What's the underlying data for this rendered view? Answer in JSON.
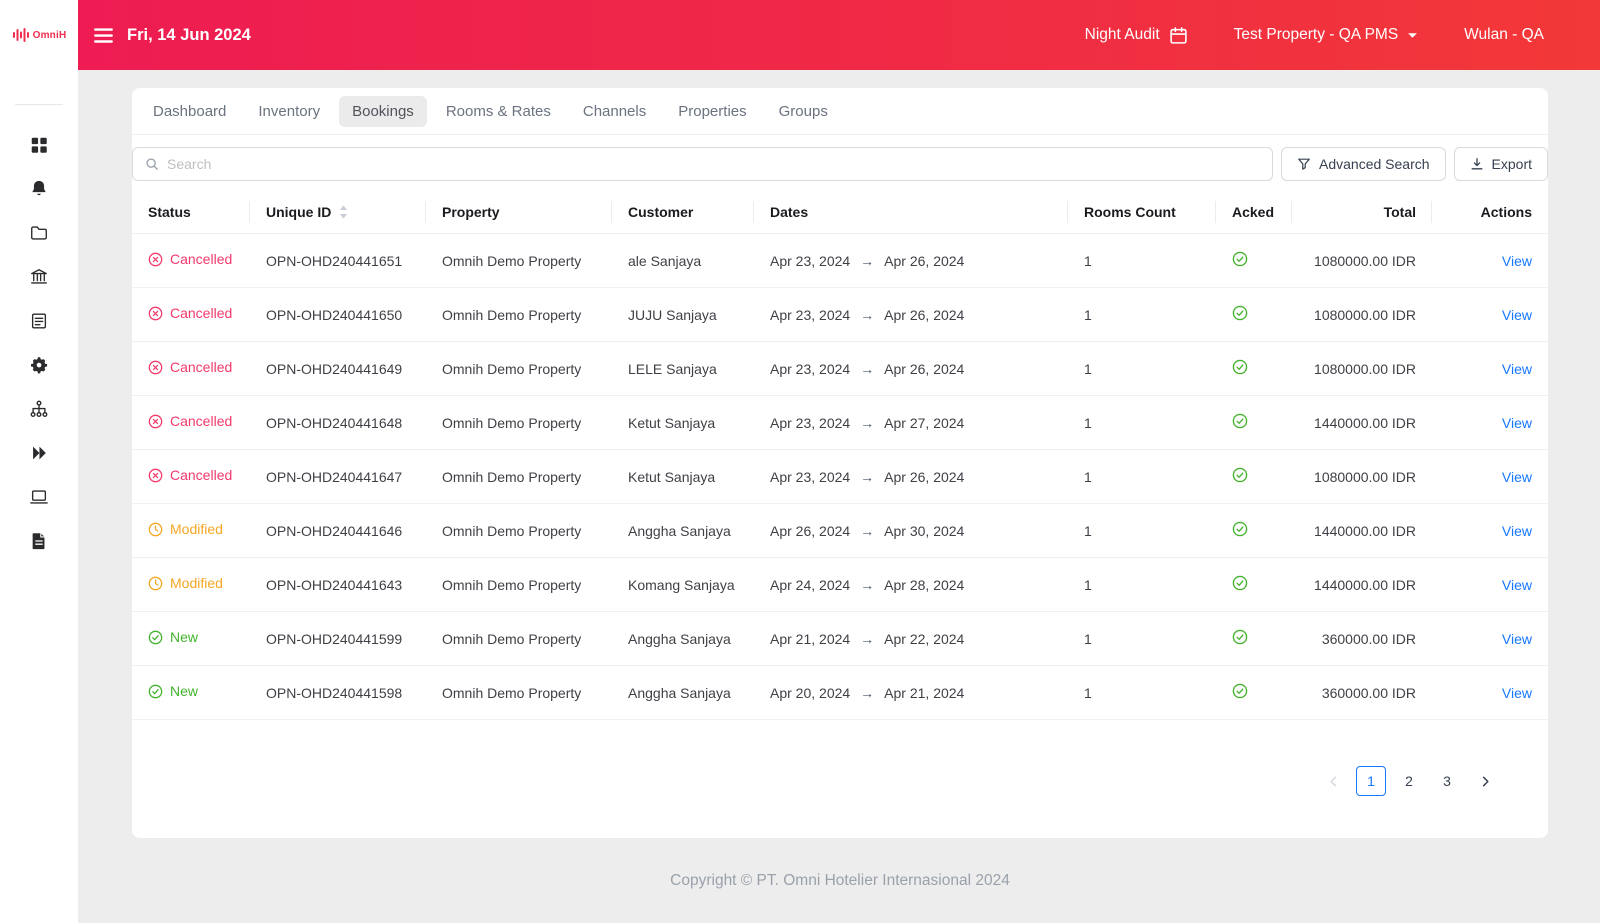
{
  "brand": {
    "logo_text": "OmniH"
  },
  "header": {
    "date": "Fri, 14 Jun 2024",
    "night_audit": "Night Audit",
    "property_selector": "Test Property - QA PMS",
    "user": "Wulan - QA"
  },
  "sidebar": {
    "items": [
      {
        "icon": "dashboard-icon"
      },
      {
        "icon": "notifications-icon"
      },
      {
        "icon": "folder-icon"
      },
      {
        "icon": "property-icon"
      },
      {
        "icon": "form-icon"
      },
      {
        "icon": "settings-icon"
      },
      {
        "icon": "cluster-icon"
      },
      {
        "icon": "double-chevron-icon"
      },
      {
        "icon": "laptop-icon"
      },
      {
        "icon": "report-icon"
      }
    ]
  },
  "tabs": [
    {
      "label": "Dashboard",
      "active": false
    },
    {
      "label": "Inventory",
      "active": false
    },
    {
      "label": "Bookings",
      "active": true
    },
    {
      "label": "Rooms & Rates",
      "active": false
    },
    {
      "label": "Channels",
      "active": false
    },
    {
      "label": "Properties",
      "active": false
    },
    {
      "label": "Groups",
      "active": false
    }
  ],
  "toolbar": {
    "search_placeholder": "Search",
    "advanced_search_label": "Advanced Search",
    "export_label": "Export"
  },
  "table": {
    "dates_separator": "→",
    "columns": [
      {
        "label": "Status",
        "align": "left",
        "sortable": false
      },
      {
        "label": "Unique ID",
        "align": "left",
        "sortable": true
      },
      {
        "label": "Property",
        "align": "left",
        "sortable": false
      },
      {
        "label": "Customer",
        "align": "left",
        "sortable": false
      },
      {
        "label": "Dates",
        "align": "left",
        "sortable": false
      },
      {
        "label": "Rooms Count",
        "align": "left",
        "sortable": false
      },
      {
        "label": "Acked",
        "align": "left",
        "sortable": false
      },
      {
        "label": "Total",
        "align": "right",
        "sortable": false
      },
      {
        "label": "Actions",
        "align": "right",
        "sortable": false
      }
    ],
    "rows": [
      {
        "status": "Cancelled",
        "status_type": "cancelled",
        "unique_id": "OPN-OHD240441651",
        "property": "Omnih Demo Property",
        "customer": "ale Sanjaya",
        "date_from": "Apr 23, 2024",
        "date_to": "Apr 26, 2024",
        "rooms_count": "1",
        "acked": true,
        "total": "1080000.00 IDR",
        "action": "View"
      },
      {
        "status": "Cancelled",
        "status_type": "cancelled",
        "unique_id": "OPN-OHD240441650",
        "property": "Omnih Demo Property",
        "customer": "JUJU Sanjaya",
        "date_from": "Apr 23, 2024",
        "date_to": "Apr 26, 2024",
        "rooms_count": "1",
        "acked": true,
        "total": "1080000.00 IDR",
        "action": "View"
      },
      {
        "status": "Cancelled",
        "status_type": "cancelled",
        "unique_id": "OPN-OHD240441649",
        "property": "Omnih Demo Property",
        "customer": "LELE Sanjaya",
        "date_from": "Apr 23, 2024",
        "date_to": "Apr 26, 2024",
        "rooms_count": "1",
        "acked": true,
        "total": "1080000.00 IDR",
        "action": "View"
      },
      {
        "status": "Cancelled",
        "status_type": "cancelled",
        "unique_id": "OPN-OHD240441648",
        "property": "Omnih Demo Property",
        "customer": "Ketut Sanjaya",
        "date_from": "Apr 23, 2024",
        "date_to": "Apr 27, 2024",
        "rooms_count": "1",
        "acked": true,
        "total": "1440000.00 IDR",
        "action": "View"
      },
      {
        "status": "Cancelled",
        "status_type": "cancelled",
        "unique_id": "OPN-OHD240441647",
        "property": "Omnih Demo Property",
        "customer": "Ketut Sanjaya",
        "date_from": "Apr 23, 2024",
        "date_to": "Apr 26, 2024",
        "rooms_count": "1",
        "acked": true,
        "total": "1080000.00 IDR",
        "action": "View"
      },
      {
        "status": "Modified",
        "status_type": "modified",
        "unique_id": "OPN-OHD240441646",
        "property": "Omnih Demo Property",
        "customer": "Anggha Sanjaya",
        "date_from": "Apr 26, 2024",
        "date_to": "Apr 30, 2024",
        "rooms_count": "1",
        "acked": true,
        "total": "1440000.00 IDR",
        "action": "View"
      },
      {
        "status": "Modified",
        "status_type": "modified",
        "unique_id": "OPN-OHD240441643",
        "property": "Omnih Demo Property",
        "customer": "Komang Sanjaya",
        "date_from": "Apr 24, 2024",
        "date_to": "Apr 28, 2024",
        "rooms_count": "1",
        "acked": true,
        "total": "1440000.00 IDR",
        "action": "View"
      },
      {
        "status": "New",
        "status_type": "new",
        "unique_id": "OPN-OHD240441599",
        "property": "Omnih Demo Property",
        "customer": "Anggha Sanjaya",
        "date_from": "Apr 21, 2024",
        "date_to": "Apr 22, 2024",
        "rooms_count": "1",
        "acked": true,
        "total": "360000.00 IDR",
        "action": "View"
      },
      {
        "status": "New",
        "status_type": "new",
        "unique_id": "OPN-OHD240441598",
        "property": "Omnih Demo Property",
        "customer": "Anggha Sanjaya",
        "date_from": "Apr 20, 2024",
        "date_to": "Apr 21, 2024",
        "rooms_count": "1",
        "acked": true,
        "total": "360000.00 IDR",
        "action": "View"
      }
    ]
  },
  "pagination": {
    "pages": [
      "1",
      "2",
      "3"
    ],
    "current": "1"
  },
  "footer": {
    "copyright": "Copyright © PT. Omni Hotelier Internasional 2024"
  },
  "colors": {
    "header_gradient_start": "#ee1c52",
    "header_gradient_end": "#f23838",
    "brand_red": "#ee2d4f",
    "status_cancelled": "#f23a6b",
    "status_modified": "#f5a623",
    "status_new": "#43b32e",
    "acked_green": "#43b32e",
    "link_blue": "#1677ff",
    "pagination_active": "#1677ff"
  }
}
